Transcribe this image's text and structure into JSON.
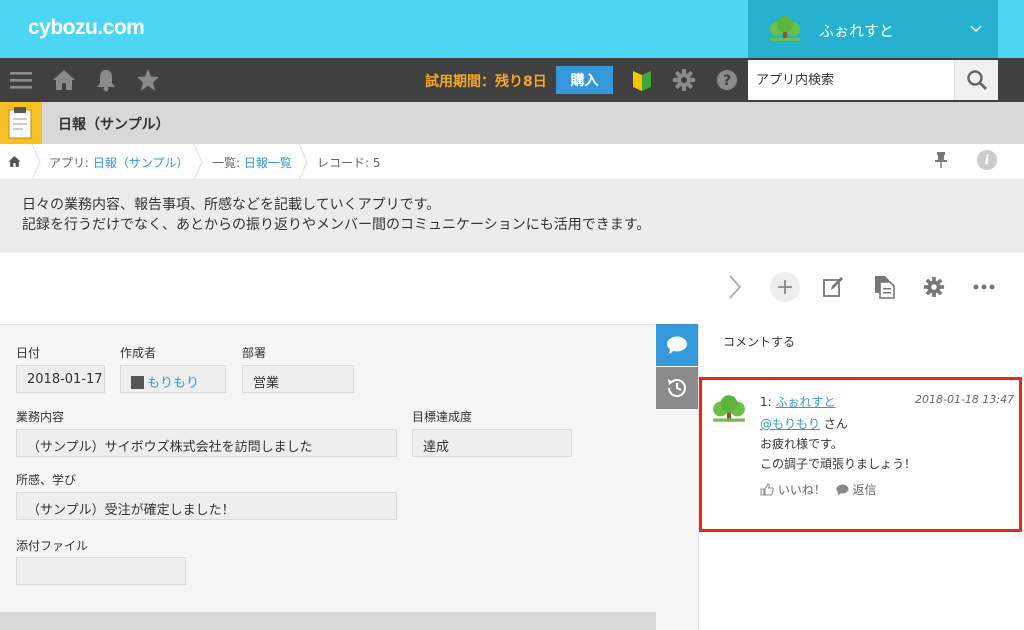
{
  "header": {
    "logo": "cybozu.com",
    "user_name": "ふぉれすと"
  },
  "nav": {
    "trial_text": "試用期間：残り8日",
    "buy_label": "購入",
    "search_placeholder": "アプリ内検索"
  },
  "app": {
    "title": "日報（サンプル）"
  },
  "breadcrumb": {
    "app_prefix": "アプリ: ",
    "app_link": "日報（サンプル）",
    "list_prefix": "一覧: ",
    "list_link": "日報一覧",
    "record": "レコード: 5"
  },
  "description": {
    "line1": "日々の業務内容、報告事項、所感などを記載していくアプリです。",
    "line2": "記録を行うだけでなく、あとからの振り返りやメンバー間のコミュニケーションにも活用できます。"
  },
  "record": {
    "date_label": "日付",
    "date_value": "2018-01-17",
    "author_label": "作成者",
    "author_value": "もりもり",
    "dept_label": "部署",
    "dept_value": "営業",
    "work_label": "業務内容",
    "work_value": "（サンプル）サイボウズ株式会社を訪問しました",
    "goal_label": "目標達成度",
    "goal_value": "達成",
    "thoughts_label": "所感、学び",
    "thoughts_value": "（サンプル）受注が確定しました！",
    "attach_label": "添付ファイル",
    "attach_value": ""
  },
  "comments": {
    "cta": "コメントする",
    "items": [
      {
        "number": "1: ",
        "author": "ふぉれすと",
        "time": "2018-01-18 13:47",
        "mention": "@もりもり",
        "mention_suffix": " さん",
        "line2": "お疲れ様です。",
        "line3": "この調子で頑張りましょう！",
        "like_label": "いいね！",
        "reply_label": "返信"
      }
    ]
  },
  "colors": {
    "topbar": "#4dd5f5",
    "user_box": "#26b1d1",
    "navbar": "#404040",
    "trial": "#f5a623",
    "buy": "#3498db",
    "link": "#3498db",
    "highlight": "#e8271a",
    "app_icon": "#f6bf26"
  },
  "icons": [
    "menu-icon",
    "home-icon",
    "bell-icon",
    "star-icon",
    "beginner-mark-icon",
    "gear-icon",
    "help-icon",
    "search-icon",
    "clipboard-icon",
    "pin-icon",
    "info-icon",
    "next-record-icon",
    "add-icon",
    "edit-icon",
    "duplicate-icon",
    "settings-icon",
    "more-icon",
    "comment-icon",
    "history-icon",
    "like-icon",
    "reply-icon"
  ]
}
